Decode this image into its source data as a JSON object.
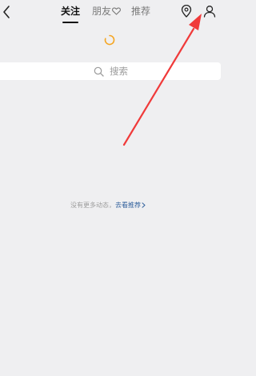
{
  "header": {
    "tabs": [
      {
        "label": "关注",
        "active": true
      },
      {
        "label": "朋友",
        "active": false,
        "icon": "heart-outline-icon"
      },
      {
        "label": "推荐",
        "active": false
      }
    ],
    "left_icon": "chevron-left-icon",
    "right_icons": [
      "location-pin-icon",
      "person-icon"
    ]
  },
  "loading_indicator": "spinner-icon",
  "search": {
    "placeholder": "搜索",
    "icon": "search-icon"
  },
  "empty_state": {
    "text": "没有更多动态，",
    "link_label": "去看推荐",
    "link_icon": "chevron-right-icon"
  },
  "annotation": {
    "type": "arrow",
    "color": "#f03a3a",
    "target": "person-icon"
  },
  "colors": {
    "background": "#efeff1",
    "active_tab": "#111111",
    "inactive_tab": "#7a7a7a",
    "link": "#2f5f9c",
    "spinner": "#f5a623"
  }
}
